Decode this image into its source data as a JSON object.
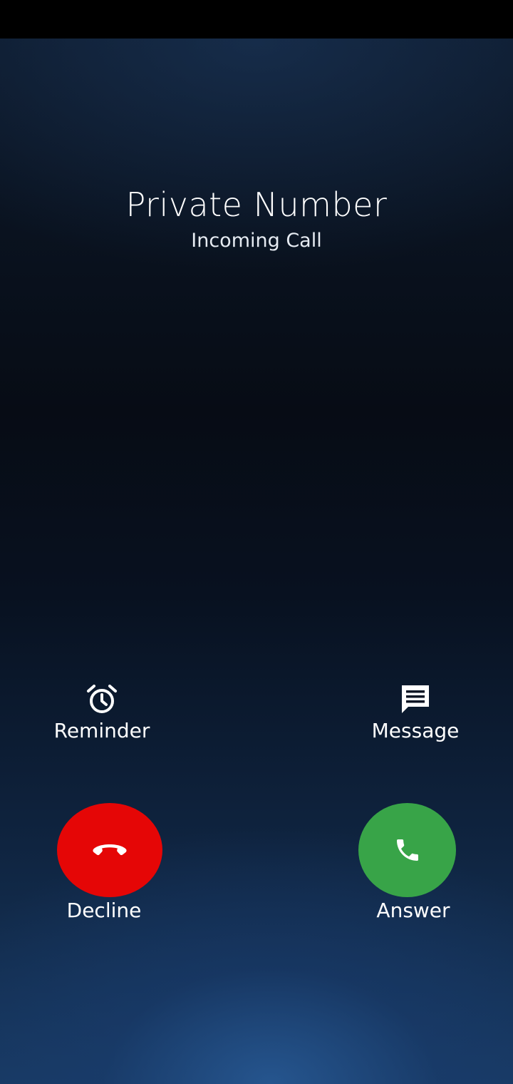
{
  "caller": {
    "name": "Private Number",
    "status": "Incoming Call"
  },
  "actions": {
    "reminder": {
      "label": "Reminder",
      "icon": "alarm-clock-icon"
    },
    "message": {
      "label": "Message",
      "icon": "message-icon"
    }
  },
  "buttons": {
    "decline": {
      "label": "Decline",
      "icon": "hang-up-icon",
      "color": "#e50606"
    },
    "answer": {
      "label": "Answer",
      "icon": "phone-icon",
      "color": "#38a448"
    }
  }
}
